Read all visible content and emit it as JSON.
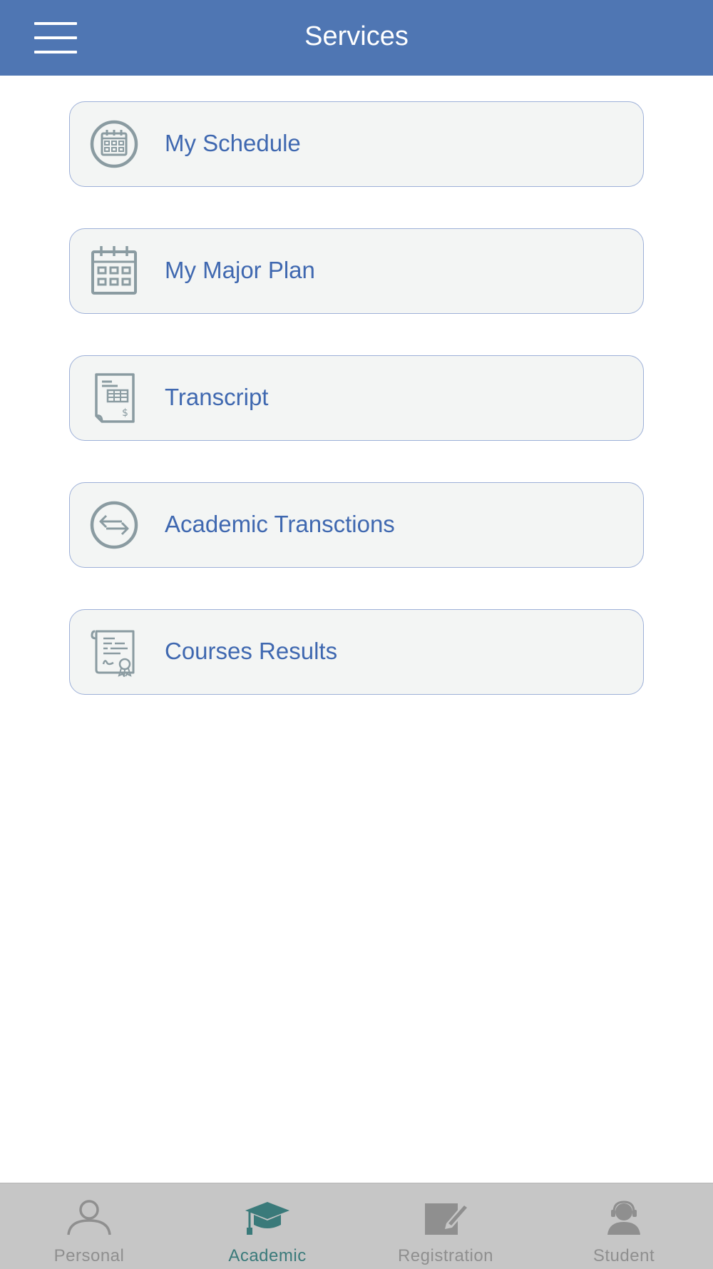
{
  "header": {
    "title": "Services",
    "menu_icon": "hamburger-icon"
  },
  "services": [
    {
      "label": "My Schedule",
      "icon": "calendar-circle-icon"
    },
    {
      "label": "My Major Plan",
      "icon": "calendar-icon"
    },
    {
      "label": "Transcript",
      "icon": "transcript-document-icon"
    },
    {
      "label": "Academic Transctions",
      "icon": "exchange-arrows-icon"
    },
    {
      "label": "Courses Results",
      "icon": "certificate-icon"
    }
  ],
  "tabs": [
    {
      "label": "Personal",
      "icon": "person-icon",
      "active": false
    },
    {
      "label": "Academic",
      "icon": "graduation-cap-icon",
      "active": true
    },
    {
      "label": "Registration",
      "icon": "edit-form-icon",
      "active": false
    },
    {
      "label": "Student",
      "icon": "student-support-icon",
      "active": false
    }
  ],
  "colors": {
    "header": "#4f76b3",
    "item_text": "#3f68b0",
    "item_bg": "#f3f5f4",
    "item_border": "#9db0d8",
    "icon_gray": "#8a9ba1",
    "tabbar_bg": "#c6c6c6",
    "tab_active": "#3a7a7a",
    "tab_inactive": "#8f8f8f"
  }
}
